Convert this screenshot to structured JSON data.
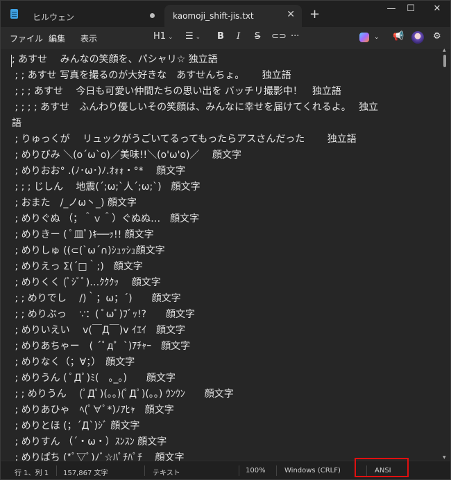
{
  "tabs": [
    {
      "label": "ヒルウェン",
      "unsaved": true
    },
    {
      "label": "kaomoji_shift-jis.txt",
      "active": true
    }
  ],
  "window_controls": {
    "minimize": "—",
    "maximize": "☐",
    "close": "✕",
    "new_tab": "+",
    "tab_close": "✕"
  },
  "menu": {
    "file": "ファイル",
    "edit": "編集",
    "view": "表示"
  },
  "toolbar": {
    "heading": "H1",
    "bold": "B",
    "italic": "I",
    "strike": "S",
    "more": "···"
  },
  "editor_lines": [
    "; あすせ　 みんなの笑顔を、パシャリ☆ 独立語",
    " ; ; あすせ 写真を撮るのが大好きな　あすせんちょ。　　 独立語",
    " ; ; ; あすせ　 今日も可愛い仲間たちの思い出を バッチリ撮影中！　独立語",
    " ; ; ; ; あすせ　ふんわり優しいその笑顔は、みんなに幸せを届けてくれるよ。　 独立",
    "語",
    " ; りゅっくが　 リュックがうごいてるってもったらアスさんだった　　 独立語",
    " ; めりびみ ＼(o´ω`o)／美味!!＼(o'ω'o)／　 顔文字",
    " ; めりおお° .(ﾉ･ω･)ﾉ.ｵｫｫ・°*　 顔文字",
    " ; ; ; じしん　 地震(´;ω;`人´;ω;`)　顔文字",
    " ; おまた　/_ノω丶_) 顔文字",
    " ; めりぐぬ （；＾ｖ＾）ぐぬぬ…　顔文字",
    " ; めりきー ( ﾟ皿ﾟ)ｷ──ｯ!! 顔文字",
    " ; めりしゅ ((⊂(`ω´∩)ｼｭｯｼｭ顔文字",
    " ; めりえっ Σ(´□｀;)　顔文字",
    " ; めりくく (ﾟｼﾞﾟ)…ｸｸｸｯ　 顔文字",
    " ; ; めりでし　 /)｀；ω；´)　　顔文字",
    " ; ; めりぶっ　 ∵：( ﾟωﾟ)ﾌﾞｯ!?　　顔文字",
    " ; めりいえい　 v(￣Д￣)v ｲｴｲ　顔文字",
    " ; めりあちゃー　( ´ﾟд゜`)ｱﾁｬｰ　顔文字",
    " ; めりなく（；∀；）　顔文字",
    " ; めりうん ( ﾟДﾟ)ﾐ(　｡_｡)　　顔文字",
    " ; ; めりうん　 (ﾟДﾟ)(｡｡)(ﾟДﾟ)(｡｡) ｳﾝｳﾝ　　顔文字",
    " ; めりあひゃ　ﾍ(ﾟ∀ﾟ*)ﾉｱﾋｬ　顔文字",
    " ; めりとほ (；´Д`)ｼﾞ 顔文字",
    " ; めりすん （´・ω・）ｽﾝｽﾝ 顔文字",
    " ; めりぱち (*ﾟ▽ﾟ)ﾉﾞ☆ﾊﾟﾁﾊﾟﾁ　 顔文字"
  ],
  "status": {
    "position": "行 1、列 1",
    "chars": "157,867 文字",
    "format": "テキスト",
    "zoom": "100%",
    "line_ending": "Windows (CRLF)",
    "encoding": "ANSI"
  },
  "colors": {
    "highlight": "#e01010",
    "editor_bg": "#262626"
  }
}
